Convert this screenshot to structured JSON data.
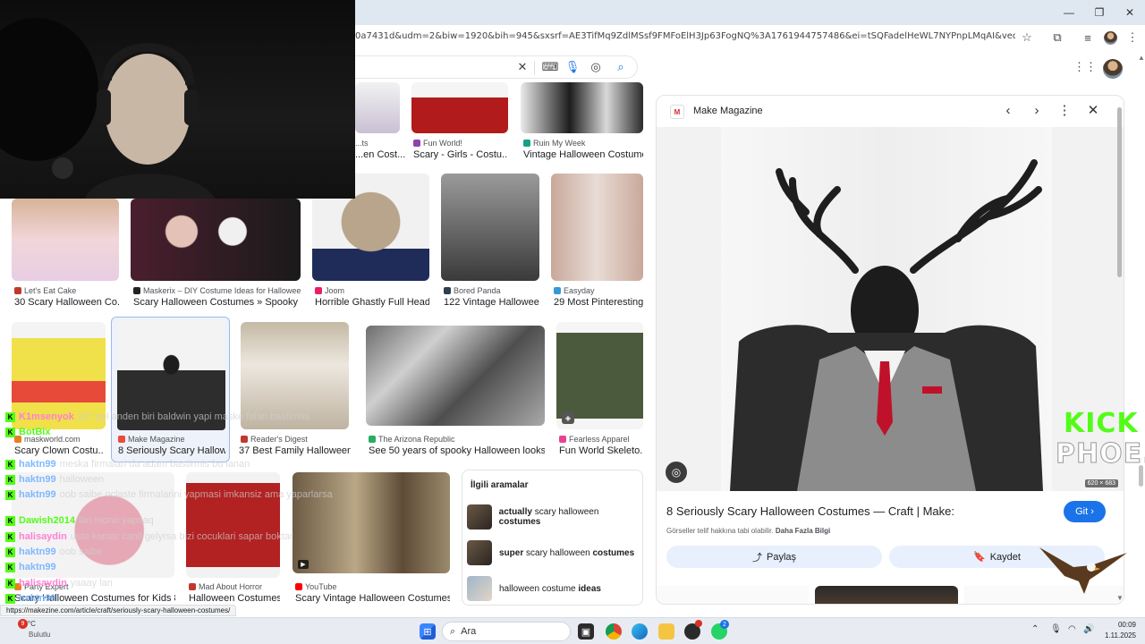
{
  "browser": {
    "url": "0a7431d&udm=2&biw=1920&bih=945&sxsrf=AE3TifMq9ZdlMSsf9FMFoElH3Jp63FogNQ%3A1761944757486&ei=tSQFadelHeWL7NYPnpLMqAI&ved=0ahUKEwiX1ljbq8-QAxXlB..."
  },
  "grid": {
    "row0": [
      {
        "source": "...ts",
        "title": "...en Cost..."
      },
      {
        "source": "Fun World!",
        "title": "Scary - Girls - Costu..."
      },
      {
        "source": "Ruin My Week",
        "title": "Vintage Halloween Costume..."
      }
    ],
    "row1": [
      {
        "source": "Let's Eat Cake",
        "title": "30 Scary Halloween Co..."
      },
      {
        "source": "Maskerix – DIY Costume Ideas for Halloween",
        "title": "Scary Halloween Costumes » Spooky DI..."
      },
      {
        "source": "Joom",
        "title": "Horrible Ghastly Full Head..."
      },
      {
        "source": "Bored Panda",
        "title": "122 Vintage Hallowee..."
      },
      {
        "source": "Easyday",
        "title": "29 Most Pinteresting..."
      }
    ],
    "row2": [
      {
        "source": "maskworld.com",
        "title": "Scary Clown Costu..."
      },
      {
        "source": "Make Magazine",
        "title": "8 Seriously Scary Hallow..."
      },
      {
        "source": "Reader's Digest",
        "title": "37 Best Family Halloween ..."
      },
      {
        "source": "The Arizona Republic",
        "title": "See 50 years of spooky Halloween looks in..."
      },
      {
        "source": "Fearless Apparel",
        "title": "Fun World Skeleto..."
      }
    ],
    "row3": [
      {
        "source": "Party Expert",
        "title": "Scary Halloween Costumes for Kids 8 ..."
      },
      {
        "source": "Mad About Horror",
        "title": "Halloween Costumes..."
      },
      {
        "source": "YouTube",
        "title": "Scary Vintage Halloween Costumes -..."
      }
    ]
  },
  "related": {
    "heading": "İlgili aramalar",
    "items": [
      {
        "bold_pre": "actually",
        "normal": " scary halloween ",
        "bold_post": "costumes"
      },
      {
        "bold_pre": "super",
        "normal": " scary halloween ",
        "bold_post": "costumes"
      },
      {
        "bold_pre": "",
        "normal": "halloween costume ",
        "bold_post": "ideas"
      }
    ]
  },
  "panel": {
    "source": "Make Magazine",
    "title": "8 Seriously Scary Halloween Costumes — Craft | Make:",
    "visit": "Git",
    "copyright": "Görseller telif hakkına tabi olabilir.",
    "more_info": "Daha Fazla Bilgi",
    "share": "Paylaş",
    "save": "Kaydet",
    "dimensions": "620 × 683"
  },
  "chat": [
    {
      "user": "K1msenyok",
      "color": "#ff7fd5",
      "msg": "all? gel anden biri baldwin yapi maske falan bastirmis"
    },
    {
      "user": "BotBix",
      "color": "#53fc18",
      "msg": ""
    },
    {
      "user": "haktn99",
      "color": "#7fb8ff",
      "msg": "meska firmalari da adam bastirmis bu lanan"
    },
    {
      "user": "haktn99",
      "color": "#7fb8ff",
      "msg": "halloween"
    },
    {
      "user": "haktn99",
      "color": "#7fb8ff",
      "msg": "oob saibe oclaste firmalarini yapmasi imkansiz ama yaparlarsa"
    },
    {
      "user": "Dawish2014",
      "color": "#53fc18",
      "msg": "lan mono yapsaq"
    },
    {
      "user": "halisaydin",
      "color": "#ff7fd5",
      "msg": "usta kamar canli gelyrsa bizi cocuklari sapar boktar"
    },
    {
      "user": "haktn99",
      "color": "#7fb8ff",
      "msg": "oob saibe"
    },
    {
      "user": "haktn99",
      "color": "#7fb8ff",
      "msg": ""
    },
    {
      "user": "halisaydin",
      "color": "#ff7fd5",
      "msg": "yaaay lan"
    },
    {
      "user": "haktn99",
      "color": "#7fb8ff",
      "msg": ""
    },
    {
      "user": "halisaydin",
      "color": "#ff7fd5",
      "msg": ""
    }
  ],
  "status_url": "https://makezine.com/article/craft/seriously-scary-halloween-costumes/",
  "weather": {
    "temp": "18°C",
    "desc": "Bulutlu",
    "badge": "9"
  },
  "taskbar": {
    "search": "Ara",
    "time": "00:09",
    "date": "1.11.2025",
    "whatsapp_badge": "2"
  },
  "overlay": {
    "brand": "KICK",
    "sub": "PHOE..."
  },
  "colors": {
    "accent": "#1a73e8",
    "kick_green": "#53fc18"
  }
}
